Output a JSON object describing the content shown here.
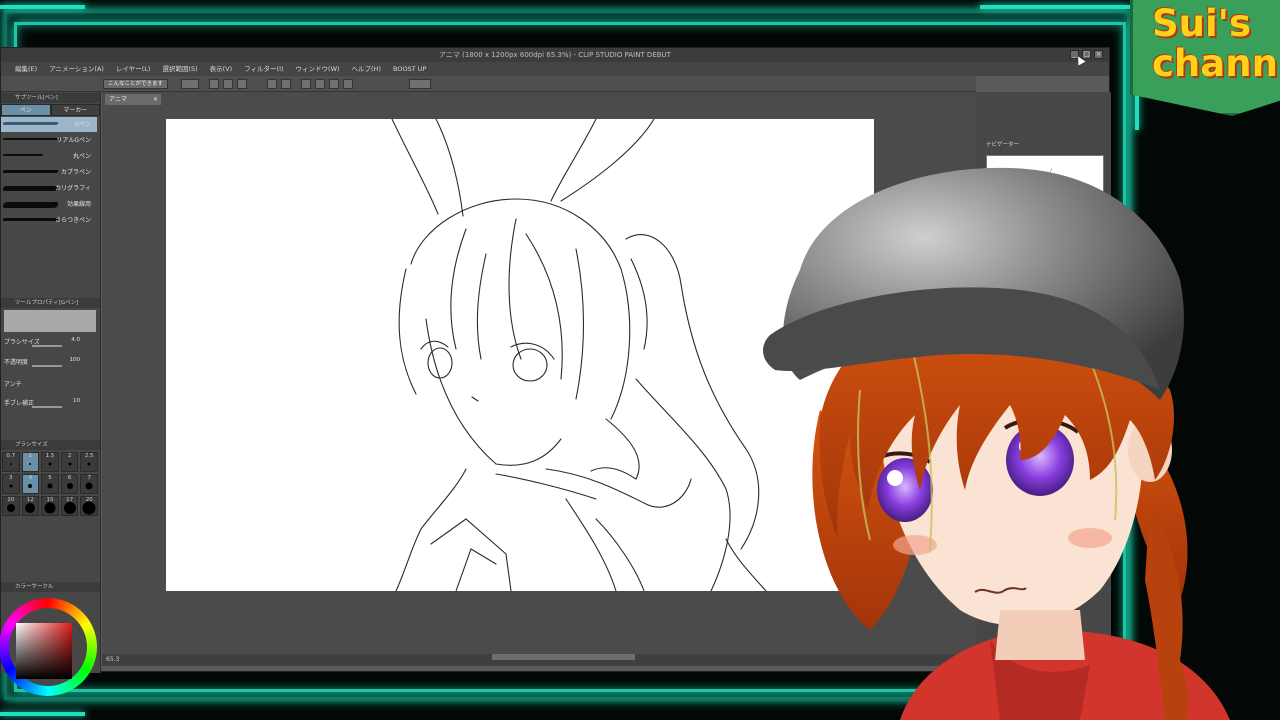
{
  "app": {
    "title": "アニマ (1800 x 1200px 600dpi 65.3%) - CLIP STUDIO PAINT DEBUT",
    "win_min": "_",
    "win_max": "□",
    "win_close": "×",
    "menu": [
      "編集(E)",
      "アニメーション(A)",
      "レイヤー(L)",
      "選択範囲(S)",
      "表示(V)",
      "フィルター(I)",
      "ウィンドウ(W)",
      "ヘルプ(H)",
      "BOOST UP",
      ""
    ],
    "toolbar_label": "こんなことができます",
    "doc_tab": "アニマ",
    "doc_tab_close": "×",
    "zoom": "65.3"
  },
  "left": {
    "subtool_header": "サブツール[ペン]",
    "tabs": [
      "ペン",
      "マーカー"
    ],
    "brushes": [
      "Gペン",
      "リアルGペン",
      "丸ペン",
      "カブラペン",
      "カリグラフィ",
      "効果線用",
      "さらつきペン"
    ],
    "property_header": "ツールプロパティ[Gペン]",
    "props": [
      {
        "label": "ブラシサイズ",
        "value": "4.0"
      },
      {
        "label": "不透明度",
        "value": "100"
      },
      {
        "label": "アンチ"
      },
      {
        "label": "手ブレ補正",
        "value": "10"
      }
    ],
    "size_header": "ブラシサイズ",
    "sizes": [
      "0.7",
      "1",
      "1.5",
      "2",
      "2.5",
      "3",
      "4",
      "5",
      "6",
      "7",
      "10",
      "12",
      "15",
      "17",
      "20"
    ],
    "color_header": "カラーサークル"
  },
  "right": {
    "navigator_header": "ナビゲーター"
  },
  "badge": {
    "line1": "Sui's",
    "line2": "chann"
  }
}
